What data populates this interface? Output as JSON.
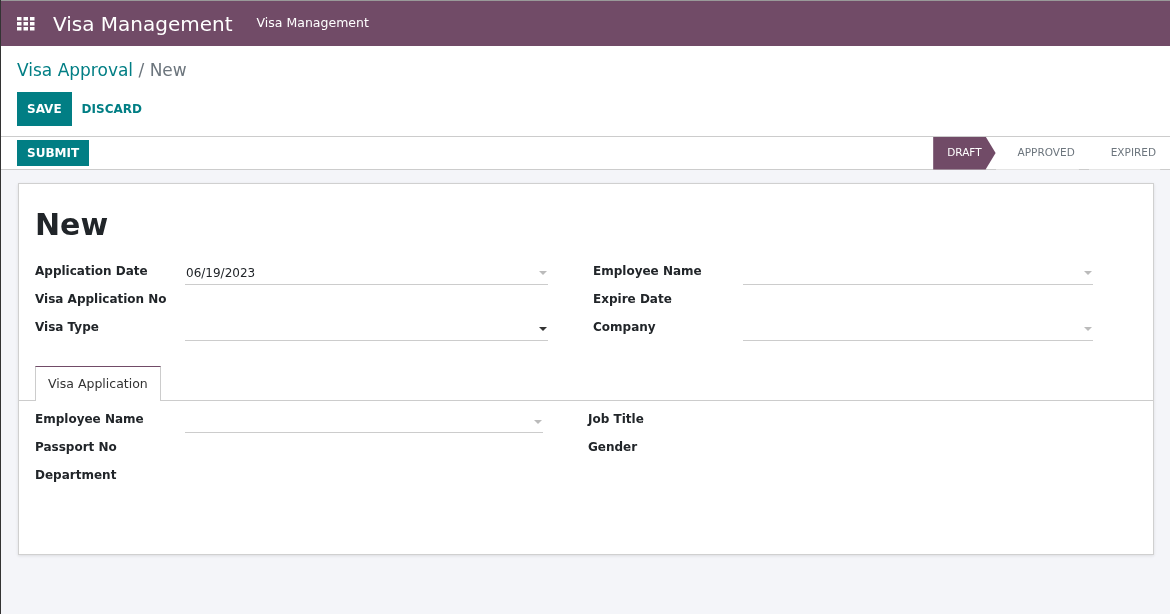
{
  "navbar": {
    "app_title": "Visa Management",
    "menu": [
      "Visa Management"
    ]
  },
  "breadcrumb": {
    "parent": "Visa Approval",
    "separator": "/",
    "current": "New"
  },
  "actions": [
    "SAVE",
    "DISCARD"
  ],
  "statusbar": {
    "button": "SUBMIT",
    "stages": [
      {
        "label": "DRAFT",
        "selected": true
      },
      {
        "label": "APPROVED",
        "selected": false
      },
      {
        "label": "EXPIRED",
        "selected": false
      }
    ]
  },
  "record": {
    "title": "New",
    "left_fields": [
      {
        "label": "Application Date",
        "kind": "dropdown",
        "required": false,
        "value": "06/19/2023"
      },
      {
        "label": "Visa Application No"
      },
      {
        "label": "Visa Type",
        "kind": "dropdown",
        "required": true
      }
    ],
    "right_fields": [
      {
        "label": "Employee Name",
        "kind": "dropdown",
        "required": false
      },
      {
        "label": "Expire Date"
      },
      {
        "label": "Company",
        "kind": "dropdown",
        "required": false
      }
    ],
    "tabs": [
      {
        "label": "Visa Application",
        "selected": true
      }
    ],
    "tab_left_fields": [
      {
        "label": "Employee Name",
        "kind": "dropdown",
        "required": false
      },
      {
        "label": "Passport No"
      },
      {
        "label": "Department"
      }
    ],
    "tab_right_fields": [
      {
        "label": "Job Title"
      },
      {
        "label": "Gender"
      }
    ]
  }
}
